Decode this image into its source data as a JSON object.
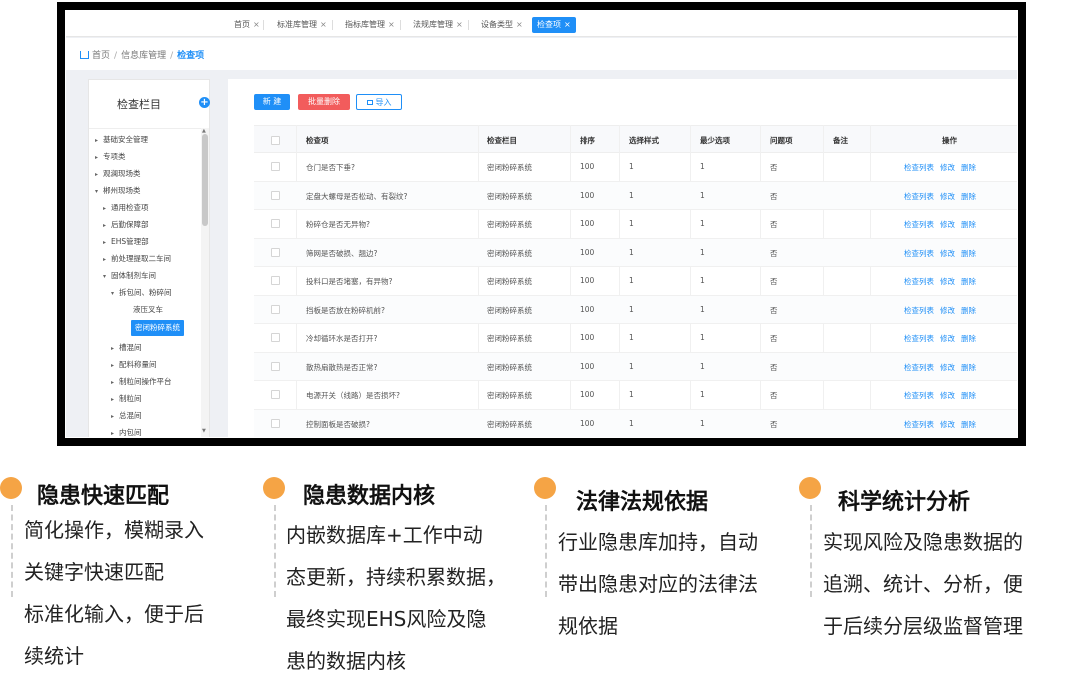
{
  "tabs": [
    {
      "label": "首页",
      "active": false
    },
    {
      "label": "标准库管理",
      "active": false
    },
    {
      "label": "指标库管理",
      "active": false
    },
    {
      "label": "法规库管理",
      "active": false
    },
    {
      "label": "设备类型",
      "active": false
    },
    {
      "label": "检查项",
      "active": true
    }
  ],
  "close_glyph": "×",
  "breadcrumb": {
    "home": "首页",
    "middle": "信息库管理",
    "current": "检查项",
    "separator": "/"
  },
  "tree": {
    "title": "检查栏目",
    "add_glyph": "+",
    "items": [
      {
        "label": "基础安全管理",
        "arrow": "▸"
      },
      {
        "label": "专项类",
        "arrow": "▸"
      },
      {
        "label": "观澜现场类",
        "arrow": "▸"
      },
      {
        "label": "郴州现场类",
        "arrow": "▾"
      },
      {
        "label": "通用检查项",
        "arrow": "▸"
      },
      {
        "label": "后勤保障部",
        "arrow": "▸"
      },
      {
        "label": "EHS管理部",
        "arrow": "▸"
      },
      {
        "label": "前处理提取二车间",
        "arrow": "▸"
      },
      {
        "label": "固体制剂车间",
        "arrow": "▾"
      },
      {
        "label": "拆包间、粉碎间",
        "arrow": "▾"
      },
      {
        "label": "液压叉车",
        "arrow": ""
      },
      {
        "label": "密闭粉碎系统",
        "arrow": "",
        "selected": true
      },
      {
        "label": "槽混间",
        "arrow": "▸"
      },
      {
        "label": "配料称量间",
        "arrow": "▸"
      },
      {
        "label": "制粒间操作平台",
        "arrow": "▸"
      },
      {
        "label": "制粒间",
        "arrow": "▸"
      },
      {
        "label": "总混间",
        "arrow": "▸"
      },
      {
        "label": "内包间",
        "arrow": "▸"
      }
    ]
  },
  "toolbar": {
    "new_label": "新 建",
    "batch_delete_label": "批量删除",
    "import_label": "导入"
  },
  "table": {
    "headers": [
      "检查项",
      "检查栏目",
      "排序",
      "选择样式",
      "最少选项",
      "问题项",
      "备注",
      "操作"
    ],
    "rows": [
      {
        "item": "仓门是否下垂?",
        "column": "密闭粉碎系统",
        "sort": "100",
        "style": "1",
        "min": "1",
        "problem": "否",
        "note": ""
      },
      {
        "item": "定盘大螺母是否松动、有裂纹?",
        "column": "密闭粉碎系统",
        "sort": "100",
        "style": "1",
        "min": "1",
        "problem": "否",
        "note": ""
      },
      {
        "item": "粉碎仓是否无异物?",
        "column": "密闭粉碎系统",
        "sort": "100",
        "style": "1",
        "min": "1",
        "problem": "否",
        "note": ""
      },
      {
        "item": "筛网是否破损、翘边?",
        "column": "密闭粉碎系统",
        "sort": "100",
        "style": "1",
        "min": "1",
        "problem": "否",
        "note": ""
      },
      {
        "item": "投料口是否堵塞，有异物?",
        "column": "密闭粉碎系统",
        "sort": "100",
        "style": "1",
        "min": "1",
        "problem": "否",
        "note": ""
      },
      {
        "item": "挡板是否放在粉碎机前?",
        "column": "密闭粉碎系统",
        "sort": "100",
        "style": "1",
        "min": "1",
        "problem": "否",
        "note": ""
      },
      {
        "item": "冷却循环水是否打开?",
        "column": "密闭粉碎系统",
        "sort": "100",
        "style": "1",
        "min": "1",
        "problem": "否",
        "note": ""
      },
      {
        "item": "散热扇散热是否正常?",
        "column": "密闭粉碎系统",
        "sort": "100",
        "style": "1",
        "min": "1",
        "problem": "否",
        "note": ""
      },
      {
        "item": "电源开关（线路）是否损坏?",
        "column": "密闭粉碎系统",
        "sort": "100",
        "style": "1",
        "min": "1",
        "problem": "否",
        "note": ""
      },
      {
        "item": "控制面板是否破损?",
        "column": "密闭粉碎系统",
        "sort": "100",
        "style": "1",
        "min": "1",
        "problem": "否",
        "note": ""
      }
    ],
    "actions": [
      "检查列表",
      "修改",
      "删除"
    ]
  },
  "features": [
    {
      "title": "隐患快速匹配",
      "lines": [
        "简化操作，模糊录入",
        "关键字快速匹配",
        "标准化输入，便于后",
        "续统计"
      ]
    },
    {
      "title": "隐患数据内核",
      "lines": [
        "内嵌数据库+工作中动",
        "态更新，持续积累数据，",
        "最终实现EHS风险及隐",
        "患的数据内核"
      ]
    },
    {
      "title": "法律法规依据",
      "lines": [
        "行业隐患库加持，自动",
        "带出隐患对应的法律法",
        "规依据"
      ]
    },
    {
      "title": "科学统计分析",
      "lines": [
        "实现风险及隐患数据的",
        "追溯、统计、分析，便",
        "于后续分层级监督管理"
      ]
    }
  ],
  "colors": {
    "accent": "#1f8ff7",
    "danger": "#f25c5c",
    "feature_dot": "#f5a445"
  }
}
